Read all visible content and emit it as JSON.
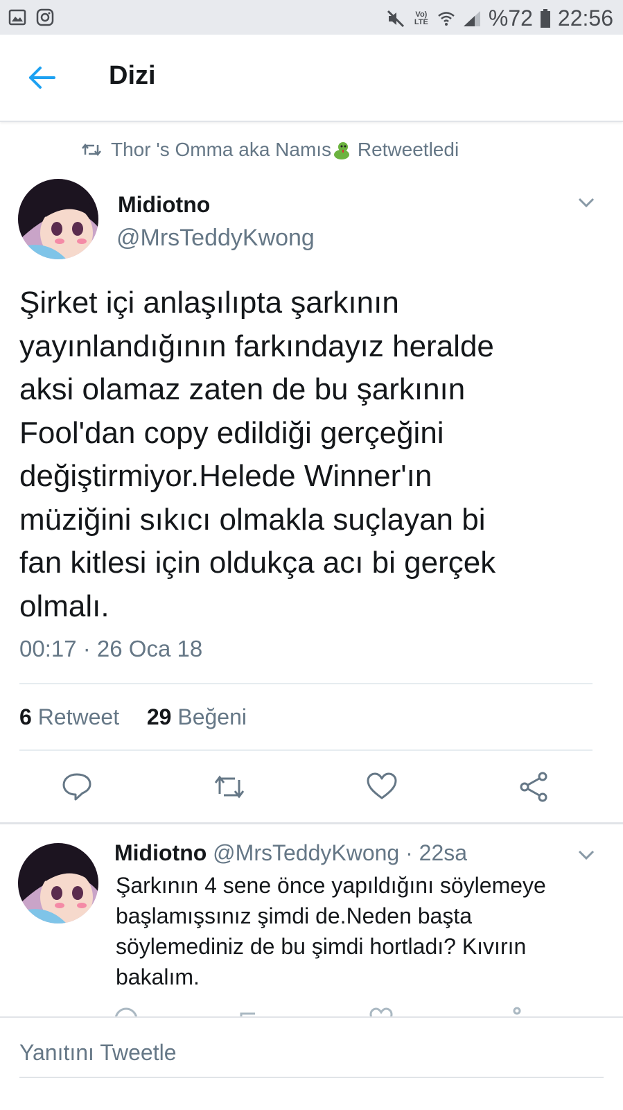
{
  "status_bar": {
    "battery": "%72",
    "time": "22:56",
    "network_label": "Vo) LTE"
  },
  "header": {
    "title": "Dizi"
  },
  "retweet_banner": {
    "text": "Thor 's Omma aka Namıs",
    "suffix": "Retweetledi"
  },
  "tweet": {
    "name": "Midiotno",
    "handle": "@MrsTeddyKwong",
    "lines": [
      "Şirket içi anlaşılıpta şarkının",
      "yayınlandığının farkındayız heralde",
      "aksi olamaz zaten de bu şarkının",
      "Fool'dan copy edildiği gerçeğini",
      "değiştirmiyor.Helede Winner'ın",
      "müziğini sıkıcı olmakla suçlayan bi",
      "fan kitlesi için oldukça acı bi gerçek",
      "olmalı."
    ],
    "timestamp": "00:17 · 26 Oca 18",
    "retweet_count": "6",
    "retweet_label": "Retweet",
    "like_count": "29",
    "like_label": "Beğeni"
  },
  "reply": {
    "name": "Midiotno",
    "handle": "@MrsTeddyKwong",
    "age": "· 22sa",
    "lines": [
      "Şarkının 4 sene önce yapıldığını söylemeye",
      "başlamışsınız şimdi de.Neden başta",
      "söylemediniz de bu şimdi hortladı? Kıvırın",
      "bakalım."
    ]
  },
  "composer": {
    "placeholder": "Yanıtını Tweetle"
  },
  "colors": {
    "accent": "#1da1f2",
    "secondary_text": "#657786",
    "primary_text": "#14171a",
    "divider": "#e6ecf0"
  },
  "icons": [
    "gallery-icon",
    "instagram-icon",
    "mute-icon",
    "wifi-icon",
    "signal-icon",
    "battery-icon",
    "back-arrow-icon",
    "retweet-icon",
    "emoji-icon",
    "chevron-down-icon",
    "reply-icon",
    "like-icon",
    "share-icon"
  ]
}
